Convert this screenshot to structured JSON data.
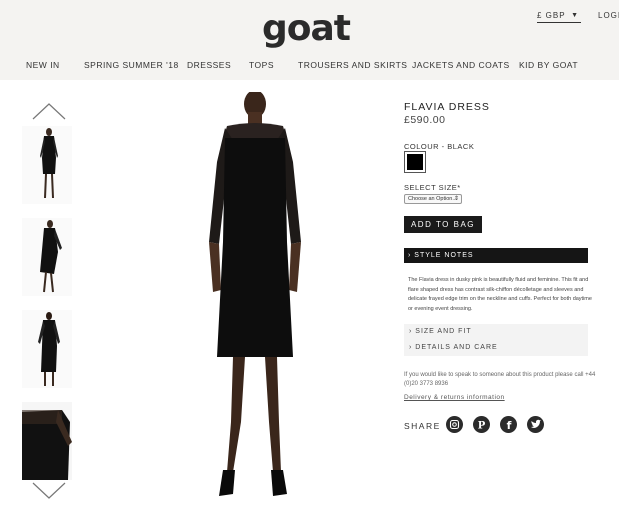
{
  "header": {
    "logo": "goat",
    "currency": "£ GBP",
    "login": "LOGI",
    "nav": [
      "NEW IN",
      "SPRING SUMMER '18",
      "DRESSES",
      "TOPS",
      "TROUSERS AND SKIRTS",
      "JACKETS AND COATS",
      "KID BY GOAT"
    ]
  },
  "product": {
    "title": "FLAVIA DRESS",
    "price": "£590.00",
    "colour_label": "COLOUR - BLACK",
    "colour_hex": "#000000",
    "size_label": "SELECT SIZE*",
    "size_placeholder": "Choose an Option...",
    "add_to_bag": "ADD TO BAG"
  },
  "style_notes": {
    "label": "STYLE NOTES",
    "text": "The Flavia dress in dusky pink is beautifully fluid and feminine. This fit and flare shaped dress has contrast silk-chiffon décolletage and sleeves and delicate frayed edge trim on the neckline and cuffs. Perfect for both daytime or evening event dressing."
  },
  "accordion": {
    "size_fit": "SIZE AND FIT",
    "details_care": "DETAILS AND CARE"
  },
  "contact": {
    "text": "If you would like to speak to someone about this product please call +44 (0)20 3773 8936",
    "delivery_link": "Delivery & returns information"
  },
  "share": {
    "label": "SHARE",
    "icons": [
      "instagram-icon",
      "pinterest-icon",
      "facebook-icon",
      "twitter-icon"
    ]
  },
  "thumbnails": {
    "count": 4
  }
}
